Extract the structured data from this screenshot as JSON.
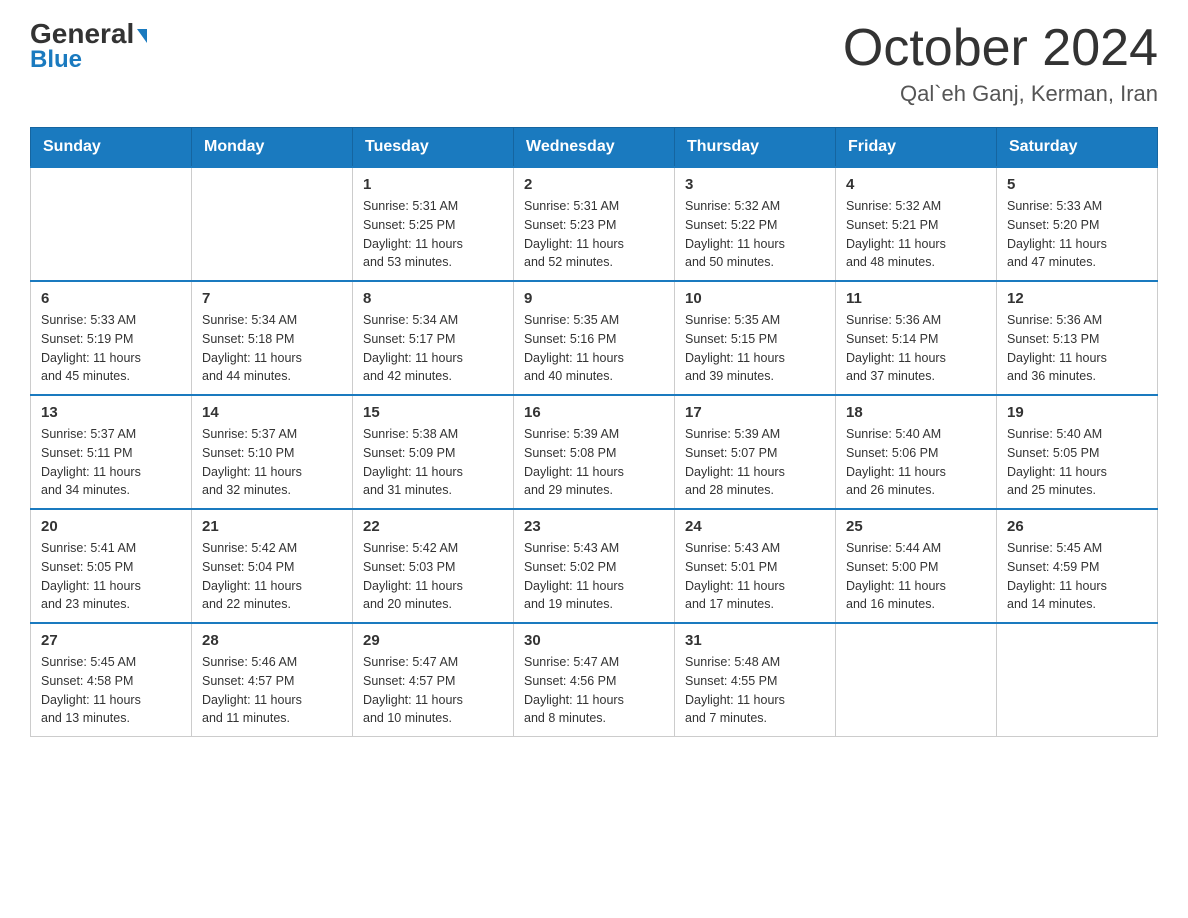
{
  "header": {
    "logo_general": "General",
    "logo_blue": "Blue",
    "month_title": "October 2024",
    "location": "Qal`eh Ganj, Kerman, Iran"
  },
  "days_of_week": [
    "Sunday",
    "Monday",
    "Tuesday",
    "Wednesday",
    "Thursday",
    "Friday",
    "Saturday"
  ],
  "weeks": [
    [
      {
        "day": "",
        "info": ""
      },
      {
        "day": "",
        "info": ""
      },
      {
        "day": "1",
        "info": "Sunrise: 5:31 AM\nSunset: 5:25 PM\nDaylight: 11 hours\nand 53 minutes."
      },
      {
        "day": "2",
        "info": "Sunrise: 5:31 AM\nSunset: 5:23 PM\nDaylight: 11 hours\nand 52 minutes."
      },
      {
        "day": "3",
        "info": "Sunrise: 5:32 AM\nSunset: 5:22 PM\nDaylight: 11 hours\nand 50 minutes."
      },
      {
        "day": "4",
        "info": "Sunrise: 5:32 AM\nSunset: 5:21 PM\nDaylight: 11 hours\nand 48 minutes."
      },
      {
        "day": "5",
        "info": "Sunrise: 5:33 AM\nSunset: 5:20 PM\nDaylight: 11 hours\nand 47 minutes."
      }
    ],
    [
      {
        "day": "6",
        "info": "Sunrise: 5:33 AM\nSunset: 5:19 PM\nDaylight: 11 hours\nand 45 minutes."
      },
      {
        "day": "7",
        "info": "Sunrise: 5:34 AM\nSunset: 5:18 PM\nDaylight: 11 hours\nand 44 minutes."
      },
      {
        "day": "8",
        "info": "Sunrise: 5:34 AM\nSunset: 5:17 PM\nDaylight: 11 hours\nand 42 minutes."
      },
      {
        "day": "9",
        "info": "Sunrise: 5:35 AM\nSunset: 5:16 PM\nDaylight: 11 hours\nand 40 minutes."
      },
      {
        "day": "10",
        "info": "Sunrise: 5:35 AM\nSunset: 5:15 PM\nDaylight: 11 hours\nand 39 minutes."
      },
      {
        "day": "11",
        "info": "Sunrise: 5:36 AM\nSunset: 5:14 PM\nDaylight: 11 hours\nand 37 minutes."
      },
      {
        "day": "12",
        "info": "Sunrise: 5:36 AM\nSunset: 5:13 PM\nDaylight: 11 hours\nand 36 minutes."
      }
    ],
    [
      {
        "day": "13",
        "info": "Sunrise: 5:37 AM\nSunset: 5:11 PM\nDaylight: 11 hours\nand 34 minutes."
      },
      {
        "day": "14",
        "info": "Sunrise: 5:37 AM\nSunset: 5:10 PM\nDaylight: 11 hours\nand 32 minutes."
      },
      {
        "day": "15",
        "info": "Sunrise: 5:38 AM\nSunset: 5:09 PM\nDaylight: 11 hours\nand 31 minutes."
      },
      {
        "day": "16",
        "info": "Sunrise: 5:39 AM\nSunset: 5:08 PM\nDaylight: 11 hours\nand 29 minutes."
      },
      {
        "day": "17",
        "info": "Sunrise: 5:39 AM\nSunset: 5:07 PM\nDaylight: 11 hours\nand 28 minutes."
      },
      {
        "day": "18",
        "info": "Sunrise: 5:40 AM\nSunset: 5:06 PM\nDaylight: 11 hours\nand 26 minutes."
      },
      {
        "day": "19",
        "info": "Sunrise: 5:40 AM\nSunset: 5:05 PM\nDaylight: 11 hours\nand 25 minutes."
      }
    ],
    [
      {
        "day": "20",
        "info": "Sunrise: 5:41 AM\nSunset: 5:05 PM\nDaylight: 11 hours\nand 23 minutes."
      },
      {
        "day": "21",
        "info": "Sunrise: 5:42 AM\nSunset: 5:04 PM\nDaylight: 11 hours\nand 22 minutes."
      },
      {
        "day": "22",
        "info": "Sunrise: 5:42 AM\nSunset: 5:03 PM\nDaylight: 11 hours\nand 20 minutes."
      },
      {
        "day": "23",
        "info": "Sunrise: 5:43 AM\nSunset: 5:02 PM\nDaylight: 11 hours\nand 19 minutes."
      },
      {
        "day": "24",
        "info": "Sunrise: 5:43 AM\nSunset: 5:01 PM\nDaylight: 11 hours\nand 17 minutes."
      },
      {
        "day": "25",
        "info": "Sunrise: 5:44 AM\nSunset: 5:00 PM\nDaylight: 11 hours\nand 16 minutes."
      },
      {
        "day": "26",
        "info": "Sunrise: 5:45 AM\nSunset: 4:59 PM\nDaylight: 11 hours\nand 14 minutes."
      }
    ],
    [
      {
        "day": "27",
        "info": "Sunrise: 5:45 AM\nSunset: 4:58 PM\nDaylight: 11 hours\nand 13 minutes."
      },
      {
        "day": "28",
        "info": "Sunrise: 5:46 AM\nSunset: 4:57 PM\nDaylight: 11 hours\nand 11 minutes."
      },
      {
        "day": "29",
        "info": "Sunrise: 5:47 AM\nSunset: 4:57 PM\nDaylight: 11 hours\nand 10 minutes."
      },
      {
        "day": "30",
        "info": "Sunrise: 5:47 AM\nSunset: 4:56 PM\nDaylight: 11 hours\nand 8 minutes."
      },
      {
        "day": "31",
        "info": "Sunrise: 5:48 AM\nSunset: 4:55 PM\nDaylight: 11 hours\nand 7 minutes."
      },
      {
        "day": "",
        "info": ""
      },
      {
        "day": "",
        "info": ""
      }
    ]
  ]
}
